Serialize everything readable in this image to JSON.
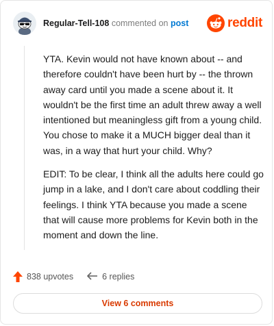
{
  "comment": {
    "username": "Regular-Tell-108",
    "verb": "commented on",
    "target": "post",
    "avatar_icon": "snoo-avatar-icon",
    "paragraphs": [
      "YTA. Kevin would not have known about -- and therefore couldn't have been hurt by -- the thrown away card until you made a scene about it. It wouldn't be the first time an adult threw away a well intentioned but meaningless gift from a young child. You chose to make it a MUCH bigger deal than it was, in a way that hurt your child. Why?",
      "EDIT: To be clear, I think all the adults here could go jump in a lake, and I don't care about coddling their feelings. I think YTA because you made a scene that will cause more problems for Kevin both in the moment and down the line."
    ],
    "upvotes": "838 upvotes",
    "replies": "6 replies",
    "view_button": "View 6 comments"
  },
  "brand": {
    "logo_text": "reddit",
    "logo_icon": "reddit-logo-icon",
    "accent": "#ff4500",
    "link_color": "#0079d3"
  },
  "icons": {
    "upvote": "upvote-arrow-icon",
    "reply": "reply-arrow-icon"
  }
}
